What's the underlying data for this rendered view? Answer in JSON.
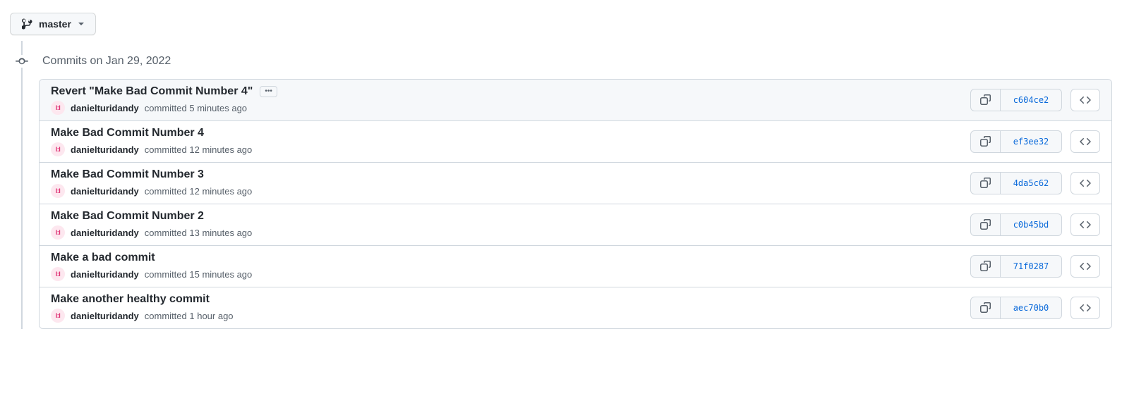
{
  "branch": {
    "name": "master"
  },
  "group_date_label": "Commits on Jan 29, 2022",
  "commits": [
    {
      "title": "Revert \"Make Bad Commit Number 4\"",
      "author": "danielturidandy",
      "time_text": "committed 5 minutes ago",
      "sha": "c604ce2",
      "show_ellipsis": true,
      "highlight": true
    },
    {
      "title": "Make Bad Commit Number 4",
      "author": "danielturidandy",
      "time_text": "committed 12 minutes ago",
      "sha": "ef3ee32",
      "show_ellipsis": false,
      "highlight": false
    },
    {
      "title": "Make Bad Commit Number 3",
      "author": "danielturidandy",
      "time_text": "committed 12 minutes ago",
      "sha": "4da5c62",
      "show_ellipsis": false,
      "highlight": false
    },
    {
      "title": "Make Bad Commit Number 2",
      "author": "danielturidandy",
      "time_text": "committed 13 minutes ago",
      "sha": "c0b45bd",
      "show_ellipsis": false,
      "highlight": false
    },
    {
      "title": "Make a bad commit",
      "author": "danielturidandy",
      "time_text": "committed 15 minutes ago",
      "sha": "71f0287",
      "show_ellipsis": false,
      "highlight": false
    },
    {
      "title": "Make another healthy commit",
      "author": "danielturidandy",
      "time_text": "committed 1 hour ago",
      "sha": "aec70b0",
      "show_ellipsis": false,
      "highlight": false
    }
  ]
}
